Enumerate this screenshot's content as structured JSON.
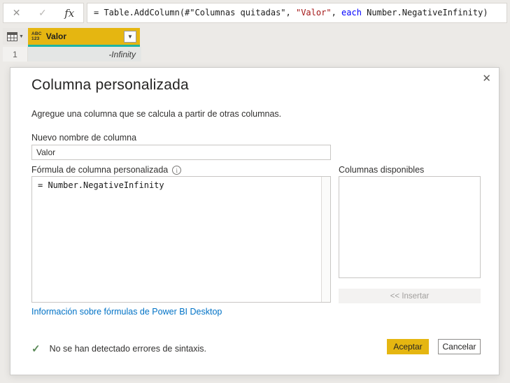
{
  "colors": {
    "accent_yellow": "#e5b611",
    "teal_accent": "#1fb3a3",
    "link_blue": "#0072c6",
    "string_red": "#a31515",
    "keyword_blue": "#0000ff",
    "success_green": "#5b8a58"
  },
  "formula_bar": {
    "cancel_icon": "✕",
    "confirm_icon": "✓",
    "fx_label": "fx",
    "code": {
      "pre": "= Table.AddColumn(#\"Columnas quitadas\", ",
      "string": "\"Valor\"",
      "sep": ", ",
      "keyword": "each",
      "post": " Number.NegativeInfinity)"
    }
  },
  "grid": {
    "corner_dropdown_icon": "▼",
    "column": {
      "type_abc": "ABC",
      "type_123": "123",
      "name": "Valor",
      "dropdown_icon": "▼"
    },
    "row": {
      "number": "1",
      "value": "-Infinity"
    }
  },
  "dialog": {
    "close_icon": "✕",
    "title": "Columna personalizada",
    "subtitle": "Agregue una columna que se calcula a partir de otras columnas.",
    "new_name_label": "Nuevo nombre de columna",
    "new_name_value": "Valor",
    "formula_label": "Fórmula de columna personalizada",
    "info_icon": "i",
    "formula_value": "= Number.NegativeInfinity",
    "available_columns_label": "Columnas disponibles",
    "insert_button_label": "<< Insertar",
    "help_link": "Información sobre fórmulas de Power BI Desktop",
    "status": {
      "check_icon": "✓",
      "text": "No se han detectado errores de sintaxis."
    },
    "accept_label": "Aceptar",
    "cancel_label": "Cancelar"
  }
}
